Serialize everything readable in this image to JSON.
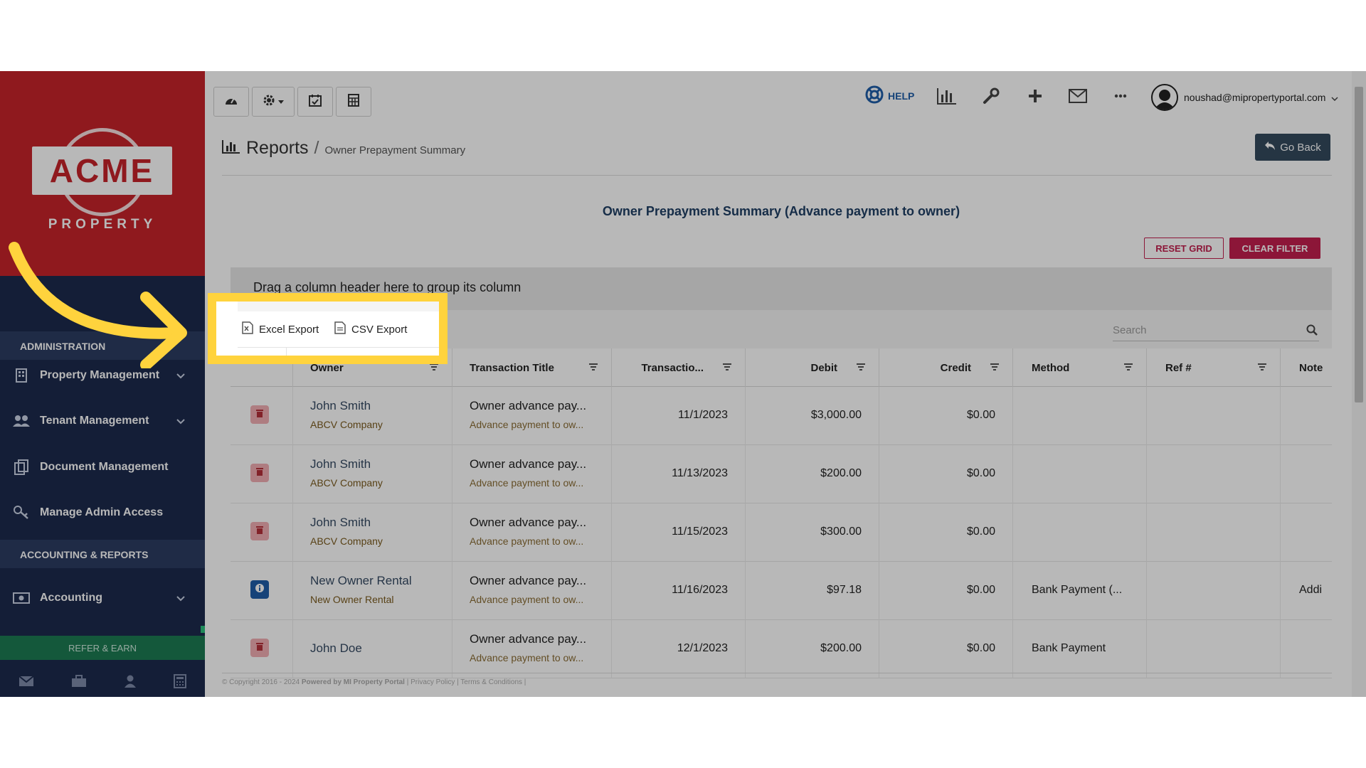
{
  "sidebar": {
    "logo": {
      "text": "ACME",
      "sub": "PROPERTY"
    },
    "sections": [
      {
        "label": "ADMINISTRATION"
      },
      {
        "label": "ACCOUNTING & REPORTS"
      }
    ],
    "items": [
      {
        "label": "Property Management",
        "icon": "building-icon",
        "expandable": true
      },
      {
        "label": "Tenant Management",
        "icon": "users-icon",
        "expandable": true
      },
      {
        "label": "Document Management",
        "icon": "documents-icon",
        "expandable": false
      },
      {
        "label": "Manage Admin Access",
        "icon": "key-icon",
        "expandable": false
      },
      {
        "label": "Accounting",
        "icon": "money-icon",
        "expandable": true
      }
    ],
    "refer_label": "REFER & EARN",
    "bottom_icons": [
      "mail-icon",
      "briefcase-icon",
      "user-icon",
      "calculator-icon"
    ]
  },
  "topbar": {
    "tool_buttons": [
      "dashboard-icon",
      "gear-icon",
      "calendar-check-icon",
      "calculator-icon"
    ],
    "help_label": "HELP",
    "icons": [
      "bar-chart-icon",
      "wrench-icon",
      "plus-icon",
      "mail-icon",
      "more-icon"
    ],
    "user_email": "noushad@mipropertyportal.com"
  },
  "page": {
    "breadcrumb_title": "Reports",
    "breadcrumb_sep": "/",
    "breadcrumb_sub": "Owner Prepayment Summary",
    "go_back_label": "Go Back",
    "report_title": "Owner Prepayment Summary (Advance payment to owner)",
    "reset_grid_label": "RESET GRID",
    "clear_filter_label": "CLEAR FILTER"
  },
  "grid": {
    "group_panel_text": "Drag a column header here to group its column",
    "search_placeholder": "Search",
    "export": {
      "excel_label": "Excel Export",
      "csv_label": "CSV Export"
    },
    "columns": [
      "Owner",
      "Transaction Title",
      "Transactio...",
      "Debit",
      "Credit",
      "Method",
      "Ref #",
      "Note"
    ],
    "rows": [
      {
        "action": "delete",
        "owner": "John Smith",
        "owner_sub": "ABCV Company",
        "title": "Owner advance pay...",
        "title_sub": "Advance payment to ow...",
        "date": "11/1/2023",
        "debit": "$3,000.00",
        "credit": "$0.00",
        "method": "",
        "ref": "",
        "note": ""
      },
      {
        "action": "delete",
        "owner": "John Smith",
        "owner_sub": "ABCV Company",
        "title": "Owner advance pay...",
        "title_sub": "Advance payment to ow...",
        "date": "11/13/2023",
        "debit": "$200.00",
        "credit": "$0.00",
        "method": "",
        "ref": "",
        "note": ""
      },
      {
        "action": "delete",
        "owner": "John Smith",
        "owner_sub": "ABCV Company",
        "title": "Owner advance pay...",
        "title_sub": "Advance payment to ow...",
        "date": "11/15/2023",
        "debit": "$300.00",
        "credit": "$0.00",
        "method": "",
        "ref": "",
        "note": ""
      },
      {
        "action": "info",
        "owner": "New Owner Rental",
        "owner_sub": "New Owner Rental",
        "title": "Owner advance pay...",
        "title_sub": "Advance payment to ow...",
        "date": "11/16/2023",
        "debit": "$97.18",
        "credit": "$0.00",
        "method": "Bank Payment (...",
        "ref": "",
        "note": "Addi"
      },
      {
        "action": "delete",
        "owner": "John Doe",
        "owner_sub": "",
        "title": "Owner advance pay...",
        "title_sub": "Advance payment to ow...",
        "date": "12/1/2023",
        "debit": "$200.00",
        "credit": "$0.00",
        "method": "Bank Payment",
        "ref": "",
        "note": ""
      }
    ]
  },
  "footer": {
    "copyright": "© Copyright 2016 - 2024",
    "powered": "Powered by MI Property Portal",
    "links": "| Privacy Policy | Terms & Conditions |"
  },
  "colors": {
    "brand_red": "#c6232a",
    "sidebar_navy": "#1c2a4d",
    "accent_pink": "#c21f4e",
    "highlight_yellow": "#ffd33d",
    "refer_green": "#1d7a52"
  }
}
